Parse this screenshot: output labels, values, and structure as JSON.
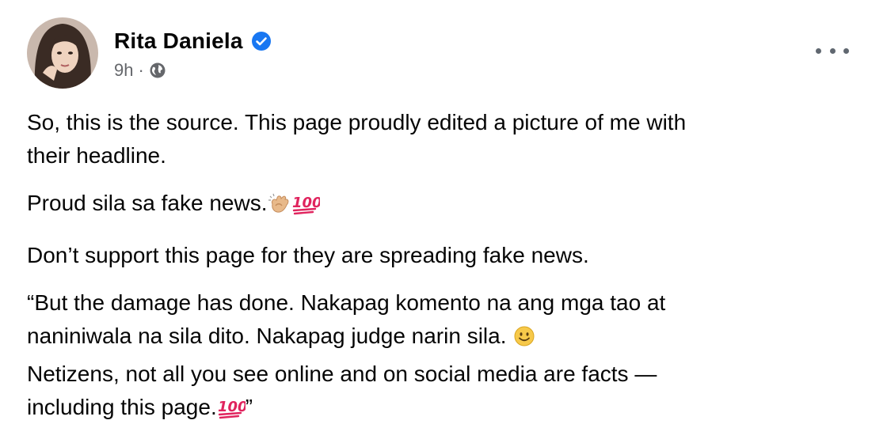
{
  "post": {
    "author": "Rita Daniela",
    "time": "9h",
    "separator": "·",
    "privacy_icon": "globe-icon",
    "verified_icon": "verified-badge-icon",
    "more_icon": "more-options-icon",
    "paragraphs": [
      {
        "lines": [
          "So, this is the source. This page proudly edited a picture of me with",
          "their headline."
        ]
      },
      {
        "lines": [
          "Proud sila sa fake news."
        ],
        "emojis": [
          "clapping-hands-emoji",
          "hundred-points-emoji"
        ]
      },
      {
        "lines": [
          "Don’t support this page for they are spreading fake news."
        ]
      },
      {
        "lines": [
          "“But the damage has done. Nakapag komento na ang mga tao at",
          "naniniwala na sila dito. Nakapag judge narin sila. ",
          "Netizens, not all you see online and on social media are facts —",
          "including this page.",
          "”"
        ],
        "emojis": [
          "smiling-face-emoji",
          "hundred-points-emoji"
        ]
      }
    ]
  },
  "colors": {
    "text": "#050505",
    "secondary_text": "#65676b",
    "verified_blue": "#1877f2",
    "emoji_red": "#e0245e"
  }
}
